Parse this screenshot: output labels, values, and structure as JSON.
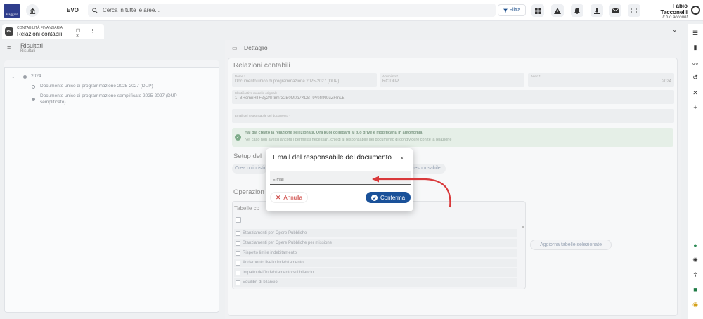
{
  "topbar": {
    "logo_text": "Maggioli",
    "app_name": "EVO",
    "search_placeholder": "Cerca in tutte le aree...",
    "filter_label": "Filtra",
    "user_name": "Fabio Tacconelli",
    "user_subtitle": "Il tuo account"
  },
  "tab": {
    "badge": "RE",
    "category": "CONTABILITÀ FINANZIARIA",
    "title": "Relazioni contabili",
    "controls": "☐ ⋮ ×"
  },
  "left": {
    "title": "Risultati",
    "subtitle": "Risultati",
    "tree_year": "2024",
    "tree_item_1": "Documento unico di programmazione 2025-2027 (DUP)",
    "tree_item_2a": "Documento unico di programmazione semplificato 2025-2027 (DUP",
    "tree_item_2b": "semplificato)"
  },
  "detail": {
    "header": "Dettaglio",
    "section_title": "Relazioni contabili",
    "fields": {
      "model_label": "Nome *",
      "model_value": "Documento unico di programmazione 2025-2027 (DUP)",
      "acronym_label": "Acronimo *",
      "acronym_value": "RC DUP",
      "year_label": "Anno *",
      "year_value": "2024",
      "id_label": "Identificativo modello originale",
      "id_value": "1_BRcmnHTFZy24P8mr32B0M0a7XDB_9VefnN9uZFInLE",
      "email_label": "Email del responsabile del documento *"
    },
    "info_line_1": "Hai già creato la relazione selezionata. Ora puoi collegarti al tuo drive e modificarla in autonomia",
    "info_line_2": "Nel caso non avessi ancora i permessi necessari, chiedi al responsabile del documento di condividere con te la relazione",
    "setup_title": "Setup del",
    "create_btn": "Crea o ripristina",
    "resp_btn": "responsabile",
    "ops_title": "Operazion",
    "tables_title": "Tabelle co",
    "tables": [
      "Stanziamenti per Opere Pubbliche",
      "Stanziamenti per Opere Pubbliche per missione",
      "Rispetto limite indebitamento",
      "Andamento livello indebitamento",
      "Impatto dell'indebitamento sul bilancio",
      "Equilibri di bilancio"
    ],
    "update_btn": "Aggiorna tabelle selezionate"
  },
  "modal": {
    "title": "Email del responsabile del documento",
    "input_placeholder": "E-mail",
    "cancel_label": "Annulla",
    "confirm_label": "Conferma"
  },
  "colors": {
    "primary": "#1a5199",
    "danger": "#c8322e",
    "annotation_arrow": "#d9393b",
    "success": "#7dab89"
  }
}
